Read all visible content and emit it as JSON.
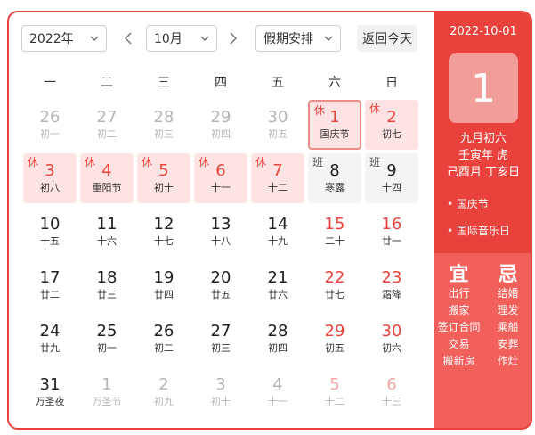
{
  "toolbar": {
    "year_select": "2022年",
    "month_select": "10月",
    "holiday_select": "假期安排",
    "today_button": "返回今天",
    "prev_icon": "chevron-left-icon",
    "next_icon": "chevron-right-icon"
  },
  "weekdays": [
    "一",
    "二",
    "三",
    "四",
    "五",
    "六",
    "日"
  ],
  "days": [
    {
      "n": "26",
      "s": "初一",
      "other": true
    },
    {
      "n": "27",
      "s": "初二",
      "other": true
    },
    {
      "n": "28",
      "s": "初三",
      "other": true
    },
    {
      "n": "29",
      "s": "初四",
      "other": true
    },
    {
      "n": "30",
      "s": "初五",
      "other": true
    },
    {
      "n": "1",
      "s": "国庆节",
      "tag": "休",
      "rest": true,
      "selected": true,
      "weekend": true
    },
    {
      "n": "2",
      "s": "初七",
      "tag": "休",
      "rest": true,
      "weekend": true
    },
    {
      "n": "3",
      "s": "初八",
      "tag": "休",
      "rest": true
    },
    {
      "n": "4",
      "s": "重阳节",
      "tag": "休",
      "rest": true
    },
    {
      "n": "5",
      "s": "初十",
      "tag": "休",
      "rest": true
    },
    {
      "n": "6",
      "s": "十一",
      "tag": "休",
      "rest": true
    },
    {
      "n": "7",
      "s": "十二",
      "tag": "休",
      "rest": true
    },
    {
      "n": "8",
      "s": "寒露",
      "tag": "班",
      "work": true
    },
    {
      "n": "9",
      "s": "十四",
      "tag": "班",
      "work": true
    },
    {
      "n": "10",
      "s": "十五"
    },
    {
      "n": "11",
      "s": "十六"
    },
    {
      "n": "12",
      "s": "十七"
    },
    {
      "n": "13",
      "s": "十八"
    },
    {
      "n": "14",
      "s": "十九"
    },
    {
      "n": "15",
      "s": "二十",
      "weekend": true
    },
    {
      "n": "16",
      "s": "廿一",
      "weekend": true
    },
    {
      "n": "17",
      "s": "廿二"
    },
    {
      "n": "18",
      "s": "廿三"
    },
    {
      "n": "19",
      "s": "廿四"
    },
    {
      "n": "20",
      "s": "廿五"
    },
    {
      "n": "21",
      "s": "廿六"
    },
    {
      "n": "22",
      "s": "廿七",
      "weekend": true
    },
    {
      "n": "23",
      "s": "霜降",
      "weekend": true
    },
    {
      "n": "24",
      "s": "廿九"
    },
    {
      "n": "25",
      "s": "初一"
    },
    {
      "n": "26",
      "s": "初二"
    },
    {
      "n": "27",
      "s": "初三"
    },
    {
      "n": "28",
      "s": "初四"
    },
    {
      "n": "29",
      "s": "初五",
      "weekend": true
    },
    {
      "n": "30",
      "s": "初六",
      "weekend": true
    },
    {
      "n": "31",
      "s": "万圣夜"
    },
    {
      "n": "1",
      "s": "万圣节",
      "other": true
    },
    {
      "n": "2",
      "s": "初九",
      "other": true
    },
    {
      "n": "3",
      "s": "初十",
      "other": true
    },
    {
      "n": "4",
      "s": "十一",
      "other": true
    },
    {
      "n": "5",
      "s": "十二",
      "other": true,
      "weekend": true
    },
    {
      "n": "6",
      "s": "十三",
      "other": true,
      "weekend": true
    }
  ],
  "detail": {
    "date": "2022-10-01",
    "day": "1",
    "lunar1": "九月初六",
    "lunar2": "壬寅年 虎",
    "lunar3": "己酉月 丁亥日",
    "festivals": [
      "国庆节",
      "国际音乐日"
    ],
    "yi_title": "宜",
    "ji_title": "忌",
    "yi": [
      "出行",
      "搬家",
      "签订合同",
      "交易",
      "搬新房"
    ],
    "ji": [
      "结婚",
      "理发",
      "乘船",
      "安葬",
      "作灶"
    ]
  },
  "colors": {
    "accent": "#e9423c",
    "rest_bg": "#fde3e3",
    "work_bg": "#f4f4f4"
  }
}
